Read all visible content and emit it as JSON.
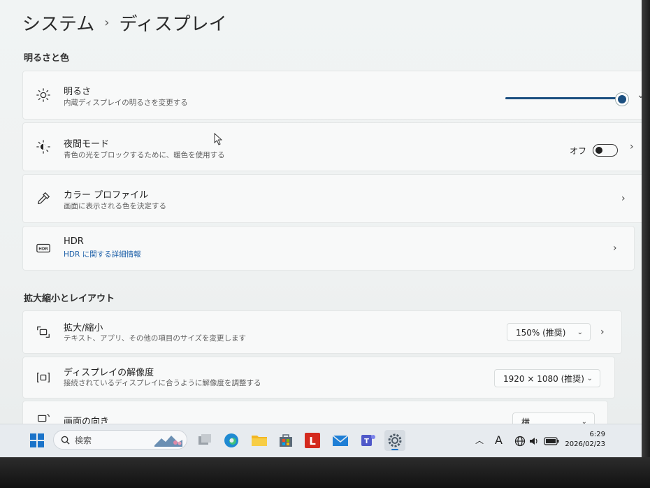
{
  "breadcrumb": {
    "parent": "システム",
    "separator": "›",
    "current": "ディスプレイ"
  },
  "sections": {
    "brightness_color": "明るさと色",
    "scale_layout": "拡大縮小とレイアウト"
  },
  "brightness": {
    "title": "明るさ",
    "subtitle": "内蔵ディスプレイの明るさを変更する",
    "value": 100,
    "icon": "sun-icon"
  },
  "night_light": {
    "title": "夜間モード",
    "subtitle": "青色の光をブロックするために、暖色を使用する",
    "toggle_label": "オフ",
    "on": false,
    "icon": "night-light-icon"
  },
  "color_profile": {
    "title": "カラー プロファイル",
    "subtitle": "画面に表示される色を決定する",
    "icon": "pipette-icon"
  },
  "hdr": {
    "title": "HDR",
    "link": "HDR に関する詳細情報",
    "icon": "hdr-icon"
  },
  "scale": {
    "title": "拡大/縮小",
    "subtitle": "テキスト、アプリ、その他の項目のサイズを変更します",
    "value": "150% (推奨)",
    "icon": "scale-icon"
  },
  "resolution": {
    "title": "ディスプレイの解像度",
    "subtitle": "接続されているディスプレイに合うように解像度を調整する",
    "value": "1920 × 1080 (推奨)",
    "icon": "resolution-icon"
  },
  "orientation": {
    "title": "画面の向き",
    "value": "横",
    "icon": "orientation-icon"
  },
  "taskbar": {
    "search_placeholder": "検索",
    "apps": [
      "start-icon",
      "file-explorer-multi-icon",
      "edge-icon",
      "folder-icon",
      "store-icon",
      "l-app-icon",
      "mail-icon",
      "teams-icon",
      "settings-icon"
    ],
    "ime": "A",
    "time": "6:29",
    "date": "2026/02/23"
  },
  "colors": {
    "accent": "#1b4f80",
    "link": "#1c5fa8"
  }
}
